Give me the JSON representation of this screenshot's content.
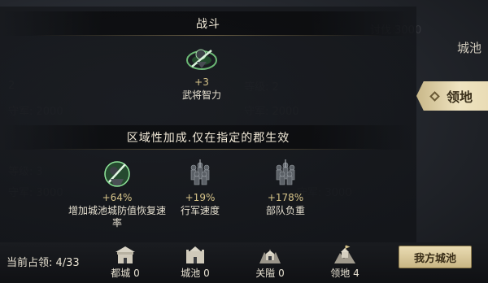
{
  "right_tabs": {
    "city": "城池",
    "territory": "领地"
  },
  "battle_section": {
    "title": "战斗",
    "bonus": {
      "value": "+3",
      "name": "武将智力",
      "icon": "general-sword-icon"
    }
  },
  "region_section": {
    "title": "区域性加成.仅在指定的郡生效",
    "bonuses": [
      {
        "value": "+64%",
        "name": "增加城池城防值恢复速率",
        "icon": "city-defense-icon"
      },
      {
        "value": "+19%",
        "name": "行军速度",
        "icon": "troops-icon"
      },
      {
        "value": "+178%",
        "name": "部队负重",
        "icon": "troops-icon"
      }
    ]
  },
  "bottom_bar": {
    "occupied": "当前占领: 4/33",
    "stats": [
      {
        "label": "都城 0",
        "icon": "capital-icon"
      },
      {
        "label": "城池 0",
        "icon": "city-icon"
      },
      {
        "label": "关隘 0",
        "icon": "pass-icon"
      },
      {
        "label": "领地 4",
        "icon": "territory-icon"
      }
    ],
    "my_city_button": "我方城池"
  },
  "colors": {
    "accent_gold": "#d7c48a",
    "tab_active": "#efe3c0"
  }
}
